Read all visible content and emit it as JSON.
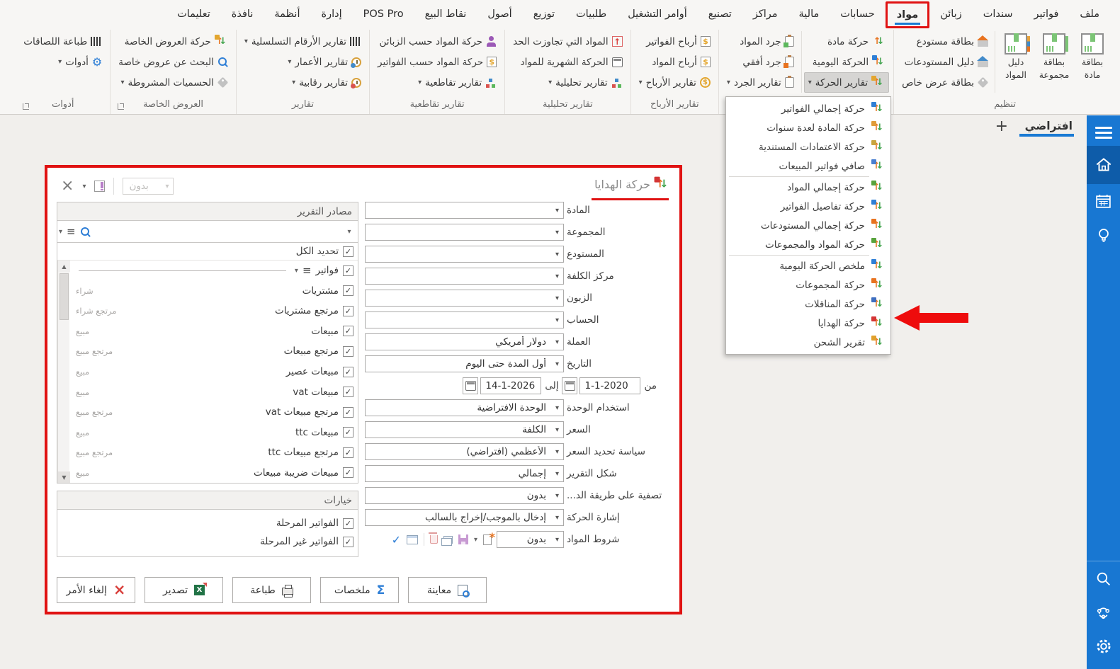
{
  "colors": {
    "accent_blue": "#1a7ad4",
    "annotation_red": "#e01212",
    "sidebar_blue": "#1877d2"
  },
  "menubar": {
    "tabs": [
      "ملف",
      "فواتير",
      "سندات",
      "زبائن",
      "مواد",
      "حسابات",
      "مالية",
      "مراكز",
      "تصنيع",
      "أوامر التشغيل",
      "طلبيات",
      "توزيع",
      "أصول",
      "نقاط البيع",
      "POS Pro",
      "إدارة",
      "أنظمة",
      "نافذة",
      "تعليمات"
    ],
    "active_tab": "مواد"
  },
  "ribbon": {
    "organize": {
      "label": "تنظيم",
      "big": [
        {
          "l1": "بطاقة",
          "l2": "مادة"
        },
        {
          "l1": "بطاقة",
          "l2": "مجموعة"
        },
        {
          "l1": "دليل",
          "l2": "المواد"
        }
      ],
      "small": [
        "بطاقة مستودع",
        "دليل المستودعات",
        "بطاقة عرض خاص"
      ]
    },
    "movement": {
      "col1": [
        "حركة مادة",
        "الحركة اليومية",
        "تقارير الحركة"
      ],
      "col2": [
        "جرد المواد",
        "جرد أفقي",
        "تقارير الجرد"
      ]
    },
    "profits": {
      "label": "تقارير الأرباح",
      "items": [
        "أرباح الفواتير",
        "أرباح المواد",
        "تقارير الأرباح"
      ]
    },
    "analytic": {
      "label": "تقارير تحليلية",
      "items": [
        "المواد التي تجاوزت الحد",
        "الحركة الشهرية للمواد",
        "تقارير تحليلية"
      ]
    },
    "cross": {
      "label": "تقارير تقاطعية",
      "items": [
        "حركة المواد حسب الزبائن",
        "حركة المواد حسب الفواتير",
        "تقارير تقاطعية"
      ]
    },
    "reports": {
      "label": "تقارير",
      "items": [
        "تقارير الأرقام التسلسلية",
        "تقارير الأعمار",
        "تقارير رقابية"
      ]
    },
    "offers": {
      "label": "العروض الخاصة",
      "items": [
        "حركة العروض الخاصة",
        "البحث عن عروض خاصة",
        "الحسميات المشروطة"
      ]
    },
    "tools": {
      "label": "أدوات",
      "items": [
        "طباعة اللصاقات",
        "أدوات"
      ]
    }
  },
  "dropdown": {
    "items": [
      "حركة إجمالي الفواتير",
      "حركة المادة لعدة سنوات",
      "حركة الاعتمادات المستندية",
      "صافي فواتير المبيعات",
      "حركة إجمالي المواد",
      "حركة تفاصيل الفواتير",
      "حركة إجمالي المستودعات",
      "حركة المواد والمجموعات",
      "ملخص الحركة اليومية",
      "حركة المجموعات",
      "حركة المناقلات",
      "حركة الهدايا",
      "تقرير الشحن"
    ]
  },
  "workspace": {
    "tab": "افتراضي",
    "new_tab": "+"
  },
  "dialog": {
    "title": "حركة الهدايا",
    "preset": "بدون",
    "sources": {
      "header": "مصادر التقرير",
      "select_all": "تحديد الكل",
      "parent": "فواتير",
      "rows": [
        {
          "label": "مشتريات",
          "tag": "شراء"
        },
        {
          "label": "مرتجع مشتريات",
          "tag": "مرتجع شراء"
        },
        {
          "label": "مبيعات",
          "tag": "مبيع"
        },
        {
          "label": "مرتجع مبيعات",
          "tag": "مرتجع مبيع"
        },
        {
          "label": "مبيعات عصير",
          "tag": "مبيع"
        },
        {
          "label": "مبيعات vat",
          "tag": "مبيع"
        },
        {
          "label": "مرتجع مبيعات vat",
          "tag": "مرتجع مبيع"
        },
        {
          "label": "مبيعات ttc",
          "tag": "مبيع"
        },
        {
          "label": "مرتجع مبيعات ttc",
          "tag": "مرتجع مبيع"
        },
        {
          "label": "مبيعات ضريبة مبيعات",
          "tag": "مبيع"
        }
      ]
    },
    "options": {
      "header": "خيارات",
      "items": [
        "الفواتير المرحلة",
        "الفواتير غير المرحلة"
      ]
    },
    "fields": [
      {
        "label": "المادة",
        "value": ""
      },
      {
        "label": "المجموعة",
        "value": ""
      },
      {
        "label": "المستودع",
        "value": ""
      },
      {
        "label": "مركز الكلفة",
        "value": ""
      },
      {
        "label": "الزبون",
        "value": ""
      },
      {
        "label": "الحساب",
        "value": ""
      },
      {
        "label": "العملة",
        "value": "دولار أمريكي"
      },
      {
        "label": "التاريخ",
        "value": "أول المدة حتى اليوم"
      }
    ],
    "date_range": {
      "from_label": "من",
      "from_value": "1-1-2020",
      "to_label": "إلى",
      "to_value": "14-1-2026"
    },
    "fields2": [
      {
        "label": "استخدام الوحدة",
        "value": "الوحدة الافتراضية"
      },
      {
        "label": "السعر",
        "value": "الكلفة"
      },
      {
        "label": "سياسة تحديد السعر",
        "value": "الأعظمي (افتراضي)"
      },
      {
        "label": "شكل التقرير",
        "value": "إجمالي"
      },
      {
        "label": "تصفية على طريقة الد...",
        "value": "بدون"
      },
      {
        "label": "إشارة الحركة",
        "value": "إدخال بالموجب/إخراج بالسالب"
      }
    ],
    "conditions": {
      "label": "شروط المواد",
      "value": "بدون"
    },
    "buttons": {
      "preview": "معاينة",
      "summaries": "ملخصات",
      "print": "طباعة",
      "export": "تصدير",
      "cancel": "إلغاء الأمر"
    }
  },
  "icons": {
    "movement": "green-down-orange-up-arrows",
    "barcode": "black-bars",
    "clock": "gold-clock",
    "gear": "blue-gear",
    "gift": "arrows-red-bow",
    "magnifier": "blue-magnifier",
    "sigma": "blue-sigma",
    "printer": "printer",
    "excel": "green-x-sheet",
    "cancel_x": "red-x",
    "home": "house",
    "calendar": "calendar-grid",
    "bulb": "lightbulb",
    "share": "network-nodes",
    "settings": "gear"
  }
}
